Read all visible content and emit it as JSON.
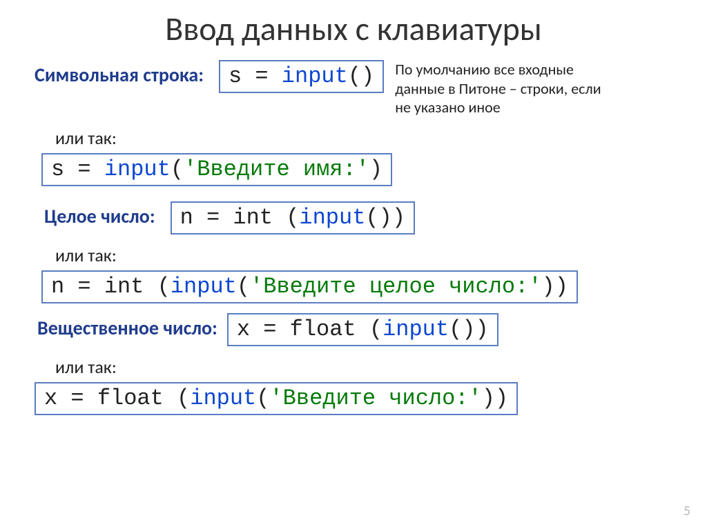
{
  "title": "Ввод данных с клавиатуры",
  "note": "По умолчанию все входные данные в Питоне – строки, если не указано иное",
  "or_label": "или так:",
  "labels": {
    "string": "Символьная строка:",
    "int": "Целое число:",
    "float": "Вещественное число:"
  },
  "code": {
    "s_input_pre": "s = ",
    "s_input_kw": "input",
    "s_input_post": "()",
    "s_prompt_pre": "s = ",
    "s_prompt_kw": "input",
    "s_prompt_open": "(",
    "s_prompt_str": "'Введите имя:'",
    "s_prompt_close": ")",
    "n_int_pre": "n = int (",
    "n_int_kw": "input",
    "n_int_post": "())",
    "n_prompt_pre": "n = int (",
    "n_prompt_kw": "input",
    "n_prompt_open": "(",
    "n_prompt_str": "'Введите целое число:'",
    "n_prompt_close": "))",
    "x_float_pre": "x = float (",
    "x_float_kw": "input",
    "x_float_post": "())",
    "x_prompt_pre": "x = float (",
    "x_prompt_kw": "input",
    "x_prompt_open": "(",
    "x_prompt_str": "'Введите число:'",
    "x_prompt_close": "))"
  },
  "pagenum": "5"
}
